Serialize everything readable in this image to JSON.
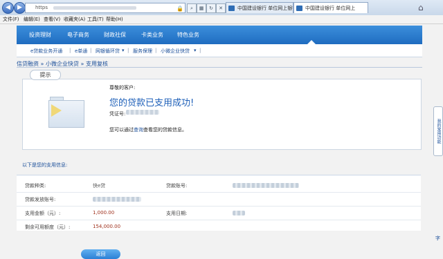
{
  "browser": {
    "address_prefix": "https",
    "tabs": [
      {
        "label": "中国建设银行 单位网上银行"
      },
      {
        "label": "中国建设银行 单位网上"
      }
    ]
  },
  "menubar": [
    "文件(F)",
    "编辑(E)",
    "查看(V)",
    "收藏夹(A)",
    "工具(T)",
    "帮助(H)"
  ],
  "banner": {
    "items": [
      "投资理财",
      "电子商务",
      "财政社保",
      "卡类业务",
      "特色业务"
    ]
  },
  "subnav": {
    "items": [
      "e贷款业务开通",
      "e单通",
      "网银循环贷",
      "服务保理",
      "小微企业快贷"
    ]
  },
  "breadcrumb": {
    "root": "信贷融资",
    "mid": "小微企业快贷",
    "current": "支用复核",
    "sep": "»"
  },
  "result": {
    "tip_label": "提示",
    "greeting": "尊敬的客户:",
    "success_message": "您的贷款已支用成功!",
    "voucher_label": "凭证号:",
    "hint_before": "您可以通过",
    "hint_link": "查询",
    "hint_after": "查看您的贷款信息。"
  },
  "details": {
    "section_title": "以下是您的支用信息:",
    "loan_type_label": "贷款种类:",
    "loan_type_value": "快e贷",
    "loan_account_label": "贷款账号:",
    "disburse_account_label": "贷款发放账号:",
    "amount_label": "支用金额（元）:",
    "amount_value": "1,000.00",
    "date_label": "支用日期:",
    "remaining_label": "剩余可用额度（元）:",
    "remaining_value": "154,000.00"
  },
  "actions": {
    "back_label": "返回"
  },
  "side_panel": {
    "label": "我的常用功能",
    "bottom_char": "字"
  }
}
